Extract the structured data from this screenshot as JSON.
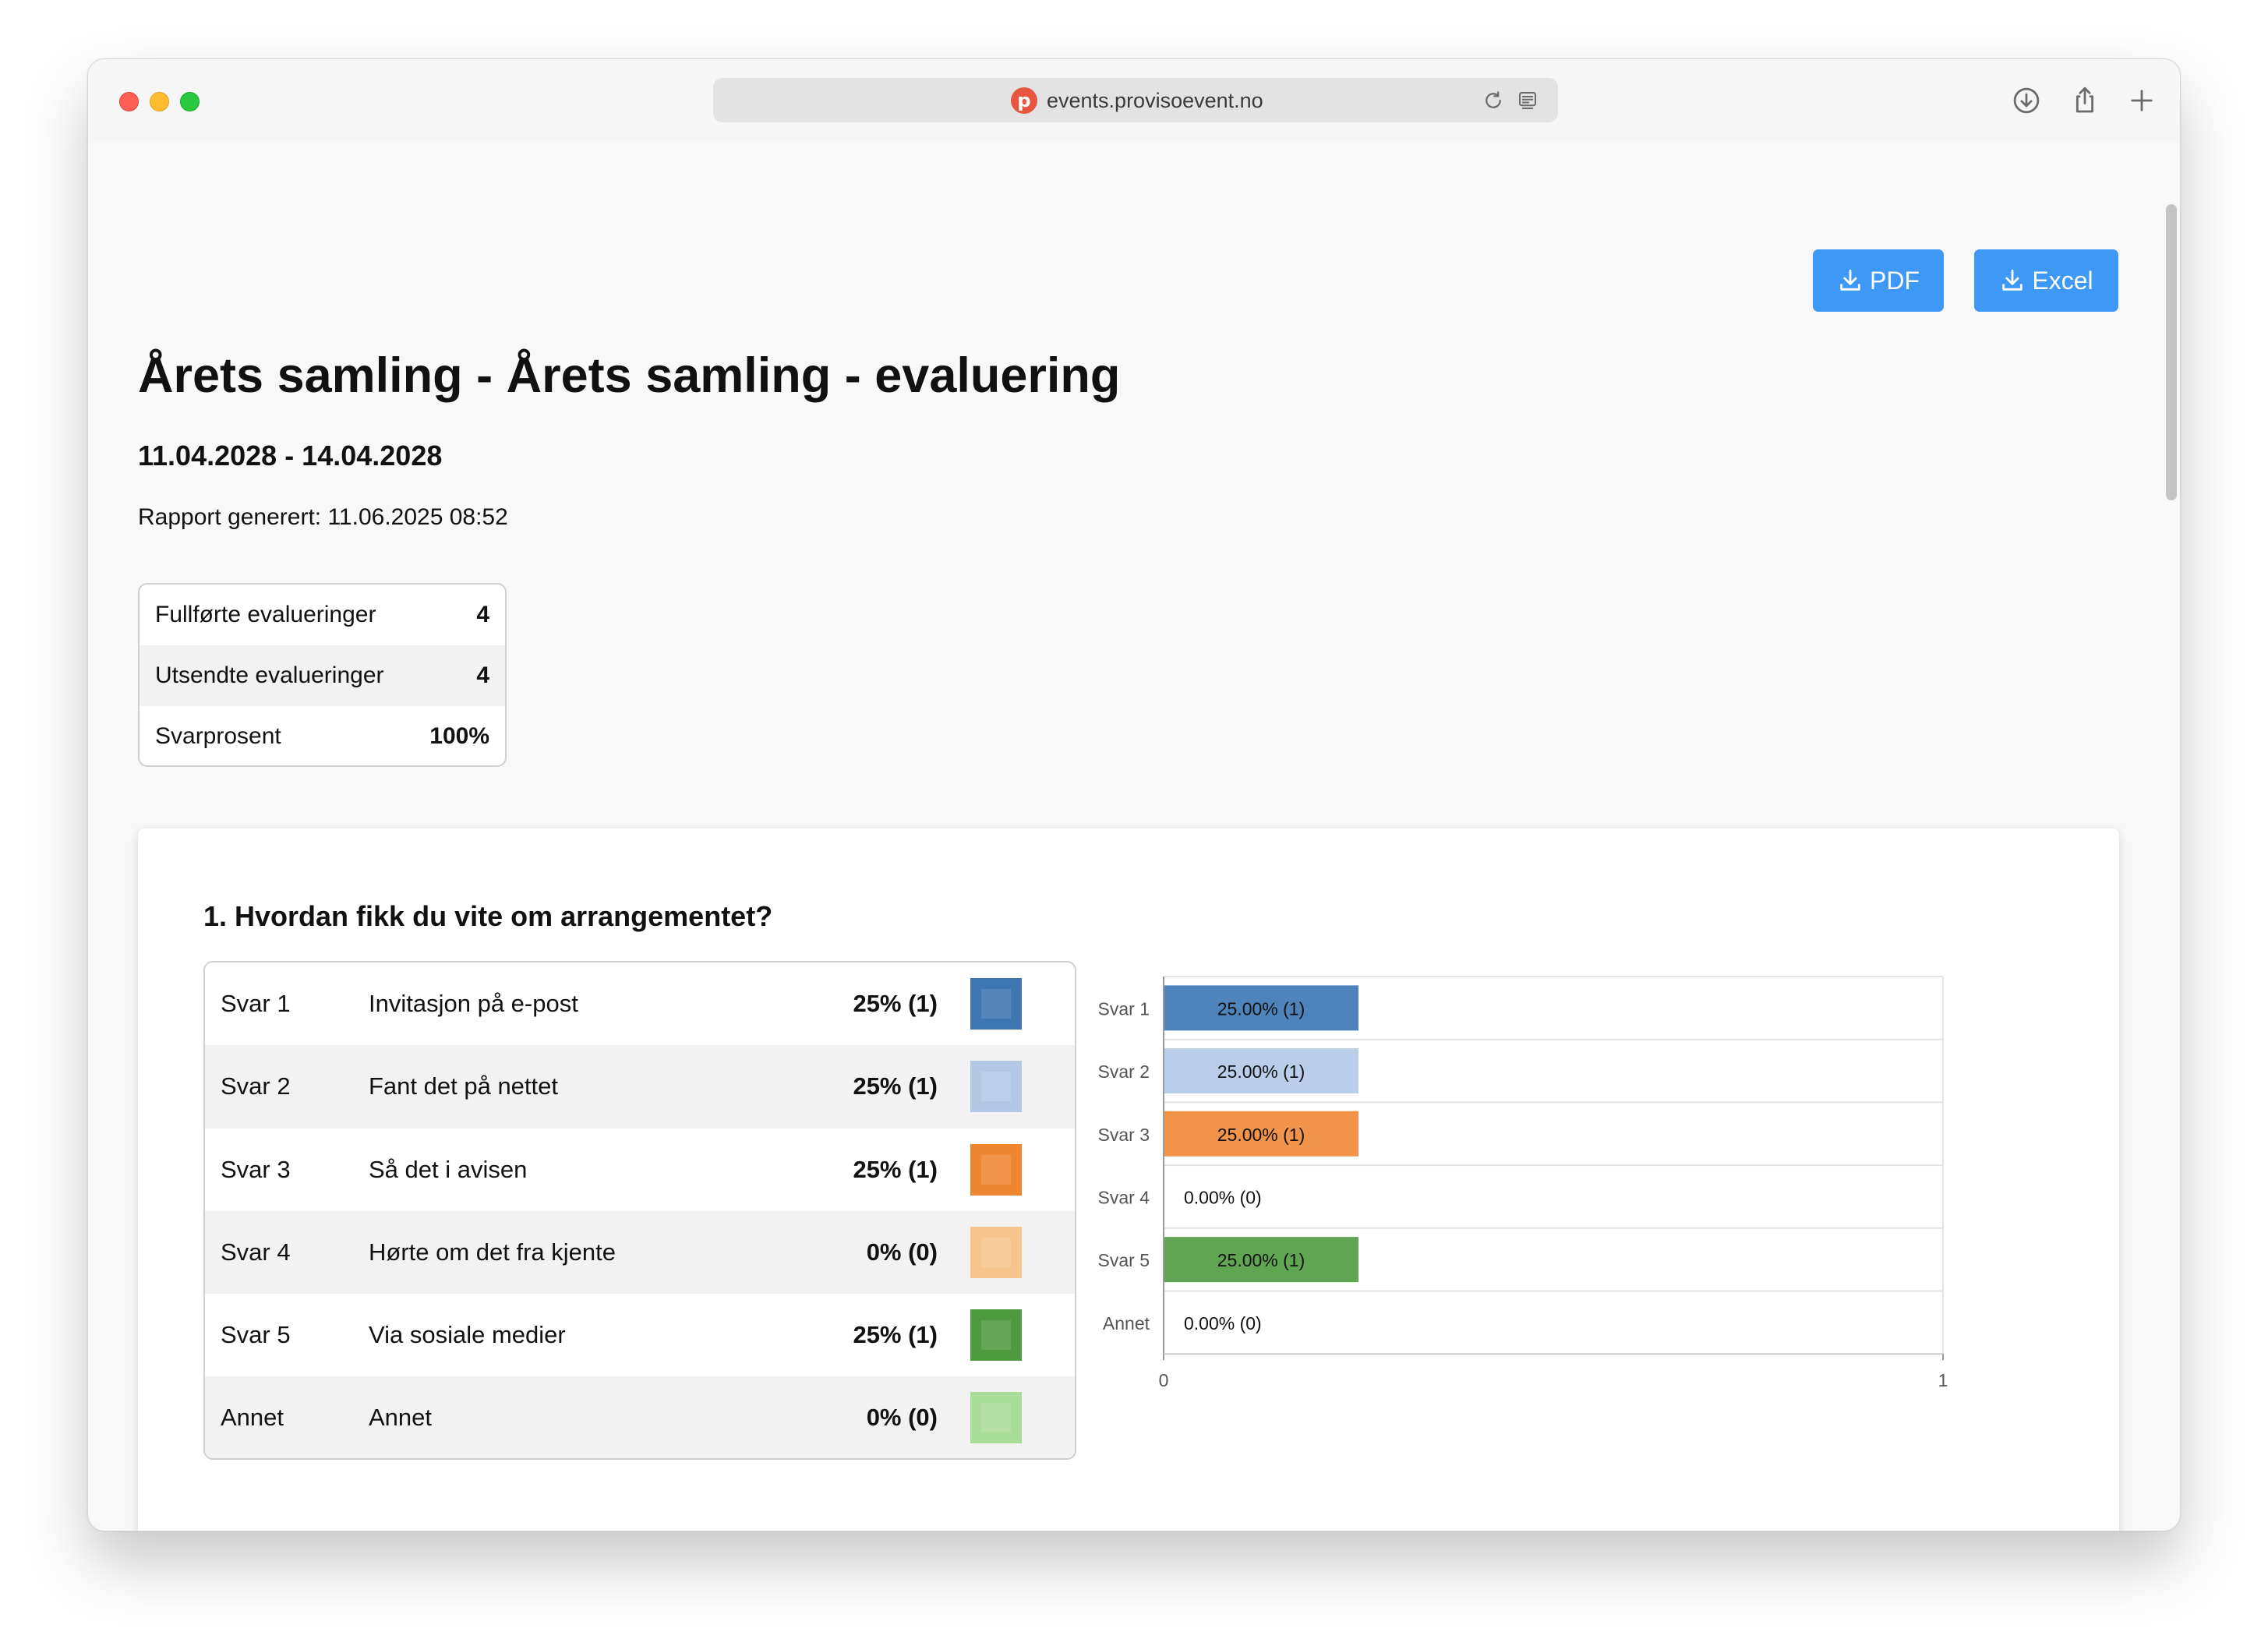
{
  "browser": {
    "url": "events.provisoevent.no",
    "site_icon_letter": "p"
  },
  "toolbar": {
    "pdf_label": "PDF",
    "excel_label": "Excel"
  },
  "report": {
    "title": "Årets samling - Årets samling - evaluering",
    "dates": "11.04.2028 - 14.04.2028",
    "generated": "Rapport generert: 11.06.2025 08:52"
  },
  "stats": [
    {
      "label": "Fullførte evalueringer",
      "value": "4"
    },
    {
      "label": "Utsendte evalueringer",
      "value": "4"
    },
    {
      "label": "Svarprosent",
      "value": "100%"
    }
  ],
  "question": {
    "title": "1. Hvordan fikk du vite om arrangementet?",
    "answers": [
      {
        "key": "Svar 1",
        "text": "Invitasjon på e-post",
        "percent": "25% (1)",
        "color": "#3d76b1"
      },
      {
        "key": "Svar 2",
        "text": "Fant det på nettet",
        "percent": "25% (1)",
        "color": "#b4c8e6"
      },
      {
        "key": "Svar 3",
        "text": "Så det i avisen",
        "percent": "25% (1)",
        "color": "#ee8631"
      },
      {
        "key": "Svar 4",
        "text": "Hørte om det fra kjente",
        "percent": "0% (0)",
        "color": "#f6c48c"
      },
      {
        "key": "Svar 5",
        "text": "Via sosiale medier",
        "percent": "25% (1)",
        "color": "#4d9a3f"
      },
      {
        "key": "Annet",
        "text": "Annet",
        "percent": "0% (0)",
        "color": "#aadd97"
      }
    ]
  },
  "chart_data": {
    "type": "bar",
    "orientation": "horizontal",
    "categories": [
      "Svar 1",
      "Svar 2",
      "Svar 3",
      "Svar 4",
      "Svar 5",
      "Annet"
    ],
    "values": [
      0.25,
      0.25,
      0.25,
      0,
      0.25,
      0
    ],
    "bar_labels": [
      "25.00% (1)",
      "25.00% (1)",
      "25.00% (1)",
      "0.00% (0)",
      "25.00% (1)",
      "0.00% (0)"
    ],
    "colors": [
      "#4e84bb",
      "#bacde9",
      "#f19348",
      "#f6c48c",
      "#5fa552",
      "#aadd97"
    ],
    "xlim": [
      0,
      1
    ],
    "x_ticks": [
      "0",
      "1"
    ],
    "grid": true
  }
}
